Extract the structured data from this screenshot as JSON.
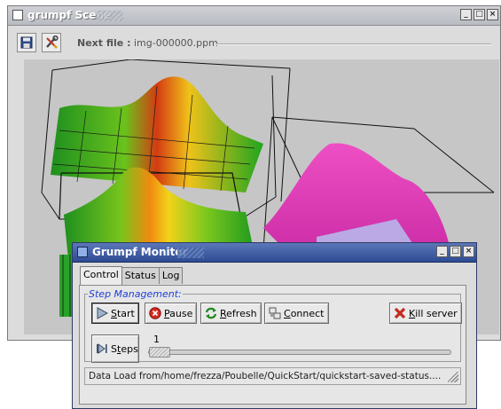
{
  "scene_window": {
    "title": "grumpf Scene",
    "toolbar": {
      "save_icon": "floppy-disk-icon",
      "tools_icon": "wrench-screwdriver-icon",
      "next_file_label": "Next file :",
      "next_file_value": "img-000000.ppm"
    },
    "window_buttons": [
      "_",
      "□",
      "×"
    ]
  },
  "monitor_window": {
    "title": "Grumpf Monitor",
    "window_buttons": [
      "_",
      "□",
      "×"
    ],
    "tabs": [
      {
        "label": "Control",
        "active": true
      },
      {
        "label": "Status",
        "active": false
      },
      {
        "label": "Log",
        "active": false
      }
    ],
    "group_title": "Step Management:",
    "buttons": {
      "start": {
        "label": "Start",
        "mnemonic": "S",
        "icon": "play-icon"
      },
      "pause": {
        "label": "Pause",
        "mnemonic": "P",
        "icon": "stop-icon"
      },
      "refresh": {
        "label": "Refresh",
        "mnemonic": "R",
        "icon": "refresh-icon"
      },
      "connect": {
        "label": "Connect",
        "mnemonic": "C",
        "icon": "connect-icon"
      },
      "kill": {
        "label": "Kill server",
        "mnemonic": "K",
        "icon": "kill-x-icon"
      },
      "steps": {
        "label": "Steps",
        "mnemonic": "t",
        "icon": "step-forward-icon"
      }
    },
    "slider": {
      "value": "1"
    },
    "status_text": "Data Load from/home/frezza/Poubelle/QuickStart/quickstart-saved-status...."
  },
  "colors": {
    "scene_titlebar": "#c3c6cc",
    "monitor_titlebar": "#3e5aa3",
    "group_title": "#1f3fd6",
    "viewport_bg": "#c6c6c6",
    "surface_green": "#1fa51f",
    "surface_pink": "#e236b6"
  }
}
